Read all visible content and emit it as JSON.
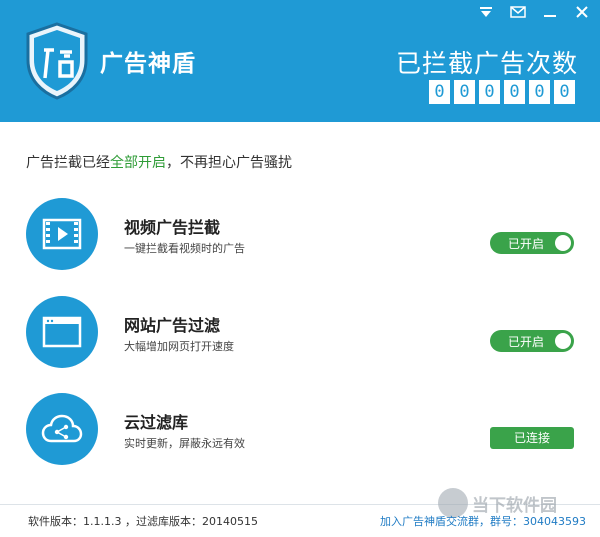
{
  "app": {
    "title": "广告神盾"
  },
  "counter": {
    "label": "已拦截广告次数",
    "digits": [
      "0",
      "0",
      "0",
      "0",
      "0",
      "0"
    ]
  },
  "status": {
    "prefix": "广告拦截已经",
    "highlight": "全部开启",
    "suffix": "，不再担心广告骚扰"
  },
  "features": [
    {
      "name": "视频广告拦截",
      "desc": "一键拦截看视频时的广告",
      "action": "已开启",
      "icon": "video-player-icon"
    },
    {
      "name": "网站广告过滤",
      "desc": "大幅增加网页打开速度",
      "action": "已开启",
      "icon": "browser-window-icon"
    },
    {
      "name": "云过滤库",
      "desc": "实时更新，屏蔽永远有效",
      "action": "已连接",
      "icon": "cloud-share-icon"
    }
  ],
  "footer": {
    "version": "软件版本：1.1.1.3 ，过滤库版本：20140515",
    "group_link": "加入广告神盾交流群，群号：304043593"
  },
  "watermark": {
    "text": "当下软件园"
  },
  "colors": {
    "header": "#1f9ad5",
    "accent_green": "#3aa34a",
    "status_green": "#2f9c37"
  }
}
